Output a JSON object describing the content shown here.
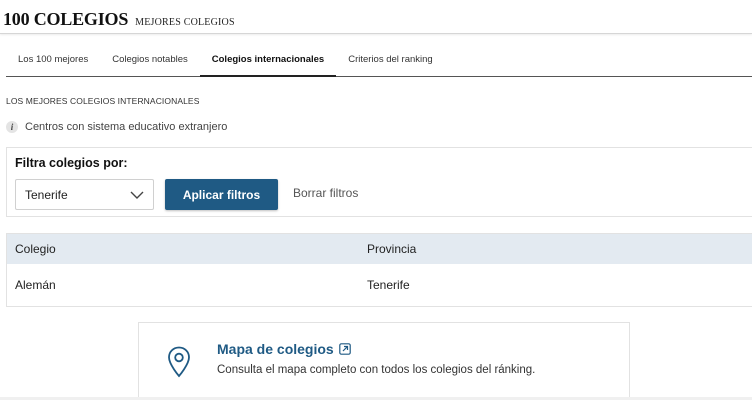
{
  "header": {
    "brand": "100 COLEGIOS",
    "subtitle": "MEJORES COLEGIOS"
  },
  "tabs": [
    {
      "label": "Los 100 mejores",
      "active": false
    },
    {
      "label": "Colegios notables",
      "active": false
    },
    {
      "label": "Colegios internacionales",
      "active": true
    },
    {
      "label": "Criterios del ranking",
      "active": false
    }
  ],
  "section": {
    "title": "LOS MEJORES COLEGIOS INTERNACIONALES",
    "info_text": "Centros con sistema educativo extranjero",
    "info_icon": "info-icon"
  },
  "filter": {
    "title": "Filtra colegios por:",
    "selected_value": "Tenerife",
    "apply_label": "Aplicar filtros",
    "clear_label": "Borrar filtros"
  },
  "table": {
    "headers": [
      "Colegio",
      "Provincia"
    ],
    "rows": [
      [
        "Alemán",
        "Tenerife"
      ]
    ]
  },
  "map_card": {
    "title": "Mapa de colegios",
    "description": "Consulta el mapa completo con todos los colegios del ránking.",
    "pin_icon": "map-pin-icon",
    "link_icon": "external-link-icon"
  },
  "colors": {
    "accent": "#1f5a84",
    "table_header_bg": "#e3eaf1"
  }
}
